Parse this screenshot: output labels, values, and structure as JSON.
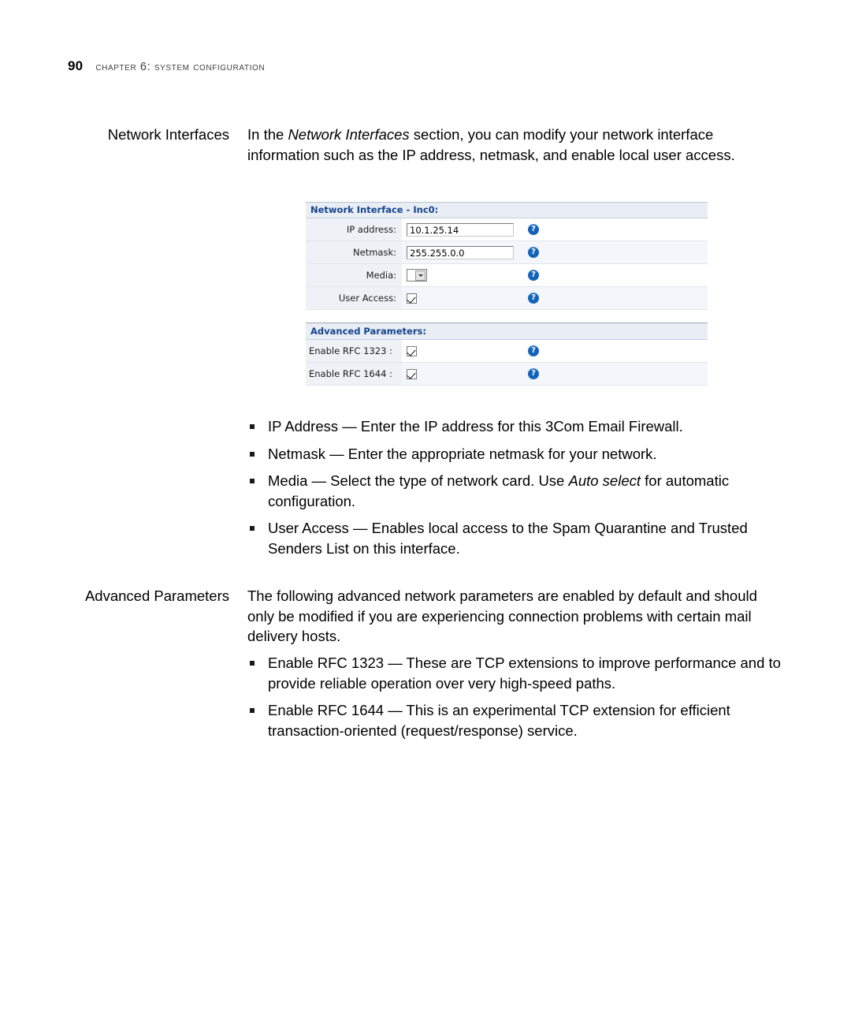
{
  "header": {
    "page_number": "90",
    "chapter": "CHAPTER 6: SYSTEM CONFIGURATION"
  },
  "sections": [
    {
      "label": "Network Interfaces",
      "paragraph_1": "In the ",
      "paragraph_italic": "Network Interfaces",
      "paragraph_2": " section, you can modify your network interface information such as the IP address, netmask, and enable local user access."
    },
    {
      "label": "Advanced Parameters",
      "paragraph": "The following advanced network parameters are enabled by default and should only be modified if you are experiencing connection problems with certain mail delivery hosts."
    }
  ],
  "figure": {
    "title": "Network Interface - Inc0:",
    "rows": [
      {
        "label": "IP address:",
        "type": "text",
        "value": "10.1.25.14",
        "help": "?"
      },
      {
        "label": "Netmask:",
        "type": "text",
        "value": "255.255.0.0",
        "help": "?"
      },
      {
        "label": "Media:",
        "type": "select",
        "value": "",
        "help": "?"
      },
      {
        "label": "User Access:",
        "type": "checkbox",
        "checked": true,
        "help": "?"
      }
    ],
    "subtitle": "Advanced Parameters:",
    "advanced_rows": [
      {
        "label": "Enable RFC 1323 :",
        "type": "checkbox",
        "checked": true,
        "help": "?"
      },
      {
        "label": "Enable RFC 1644 :",
        "type": "checkbox",
        "checked": true,
        "help": "?"
      }
    ]
  },
  "bullets_network": [
    {
      "pre": "IP Address — Enter the IP address for this 3Com Email Firewall.",
      "italic": "",
      "post": ""
    },
    {
      "pre": "Netmask — Enter the appropriate netmask for your network.",
      "italic": "",
      "post": ""
    },
    {
      "pre": "Media — Select the type of network card. Use ",
      "italic": "Auto select",
      "post": " for automatic configuration."
    },
    {
      "pre": "User Access — Enables local access to the Spam Quarantine and Trusted Senders List on this interface.",
      "italic": "",
      "post": ""
    }
  ],
  "bullets_advanced": [
    {
      "text": "Enable RFC 1323 — These are TCP extensions to improve performance and to provide reliable operation over very high-speed paths."
    },
    {
      "text": "Enable RFC 1644 — This is an experimental TCP extension for efficient transaction-oriented (request/response) service."
    }
  ]
}
